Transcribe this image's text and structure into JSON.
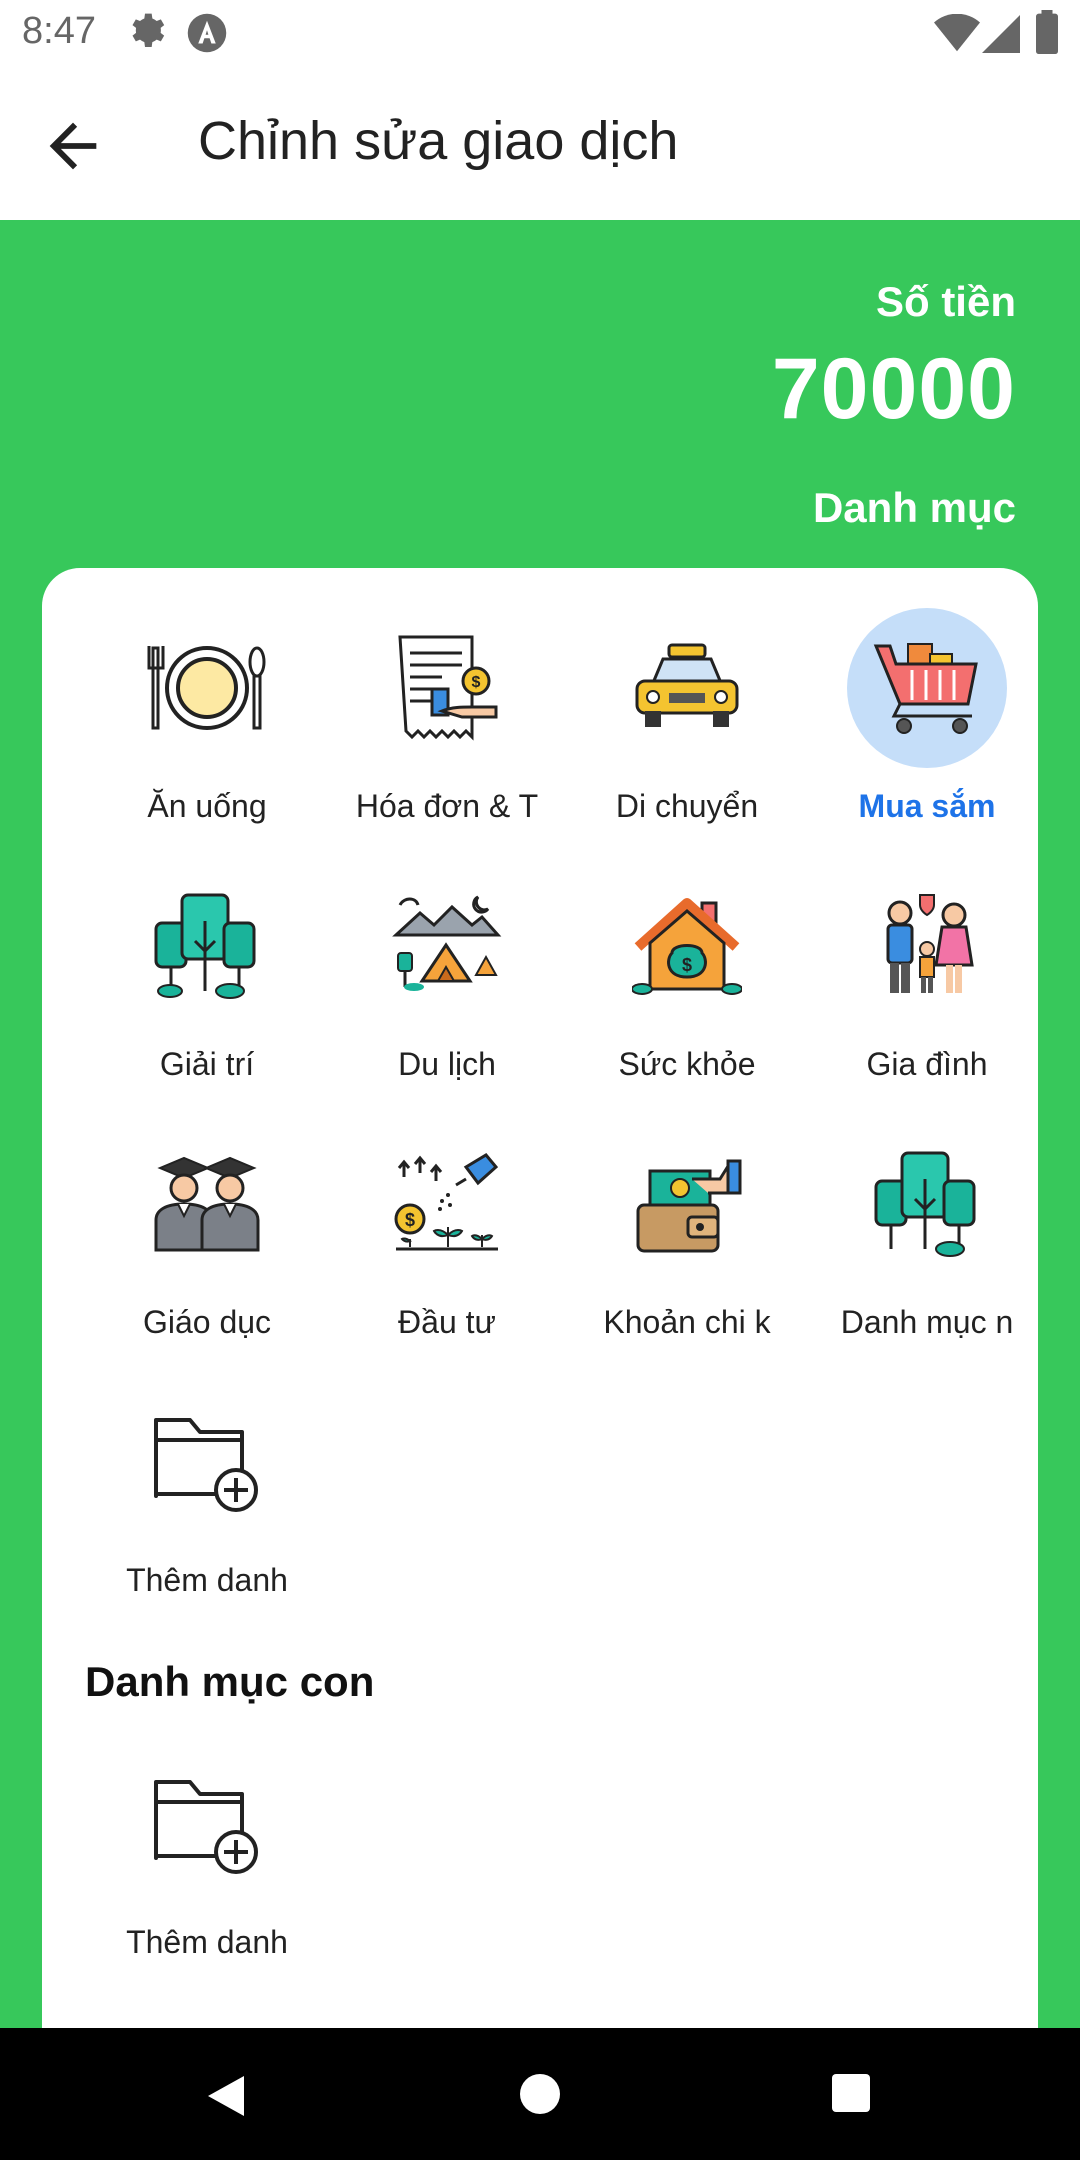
{
  "status_bar": {
    "time": "8:47",
    "icons": [
      "settings-icon",
      "a-icon",
      "wifi-icon",
      "signal-icon",
      "battery-icon"
    ]
  },
  "app_bar": {
    "title": "Chỉnh sửa giao dịch",
    "back_icon": "arrow-back-icon"
  },
  "summary": {
    "amount_label": "Số tiền",
    "amount_value": "70000",
    "category_label": "Danh mục"
  },
  "categories": [
    {
      "label": "Ăn uống",
      "icon": "plate-cutlery-icon",
      "selected": false
    },
    {
      "label": "Hóa đơn & T",
      "icon": "bill-payment-icon",
      "selected": false
    },
    {
      "label": "Di chuyển",
      "icon": "taxi-icon",
      "selected": false
    },
    {
      "label": "Mua sắm",
      "icon": "shopping-cart-icon",
      "selected": true
    },
    {
      "label": "Giải trí",
      "icon": "trees-icon",
      "selected": false
    },
    {
      "label": "Du lịch",
      "icon": "camping-icon",
      "selected": false
    },
    {
      "label": "Sức khỏe",
      "icon": "house-money-icon",
      "selected": false
    },
    {
      "label": "Gia đình",
      "icon": "family-icon",
      "selected": false
    },
    {
      "label": "Giáo dục",
      "icon": "graduates-icon",
      "selected": false
    },
    {
      "label": "Đầu tư",
      "icon": "investment-plant-icon",
      "selected": false
    },
    {
      "label": "Khoản chi k",
      "icon": "wallet-cash-icon",
      "selected": false
    },
    {
      "label": "Danh mục n",
      "icon": "trees-icon",
      "selected": false
    },
    {
      "label": "Thêm danh",
      "icon": "folder-add-icon",
      "selected": false
    }
  ],
  "subcategory": {
    "title": "Danh mục con",
    "items": [
      {
        "label": "Thêm danh",
        "icon": "folder-add-icon"
      }
    ]
  },
  "colors": {
    "green": "#37c85b",
    "selected_text": "#1e73e8",
    "selected_bg": "#c5def9"
  }
}
